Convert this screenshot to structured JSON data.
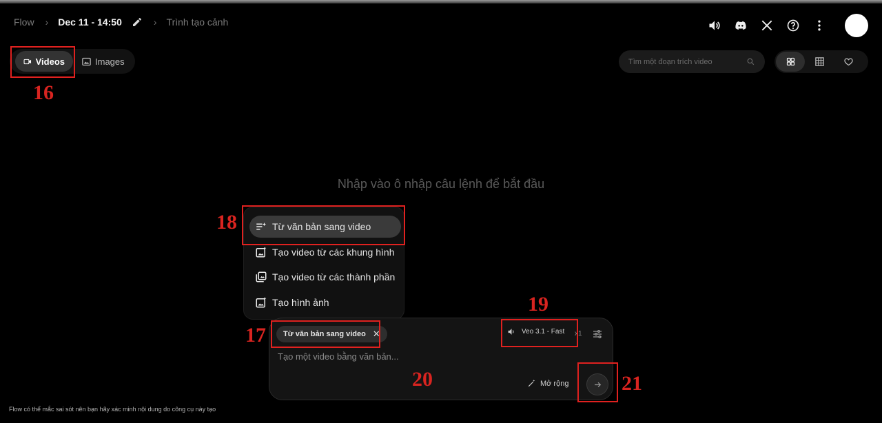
{
  "breadcrumb": {
    "root": "Flow",
    "chevron": "›",
    "project_title": "Dec 11 - 14:50",
    "page": "Trình tạo cảnh"
  },
  "header_icons": [
    "volume-icon",
    "discord-icon",
    "x-logo-icon",
    "help-icon",
    "more-vert-icon"
  ],
  "tabs": [
    {
      "label": "Videos",
      "icon": "videocam-icon",
      "active": true
    },
    {
      "label": "Images",
      "icon": "image-icon",
      "active": false
    }
  ],
  "search": {
    "placeholder": "Tìm một đoạn trích video"
  },
  "views": [
    "grid-icon",
    "grid-small-icon",
    "favorite-icon"
  ],
  "empty_message": "Nhập vào ô nhập câu lệnh để bắt đầu",
  "menu": {
    "items": [
      {
        "label": "Từ văn bản sang video",
        "icon": "text-to-video-icon",
        "selected": true
      },
      {
        "label": "Tạo video từ các khung hình",
        "icon": "frames-icon",
        "selected": false
      },
      {
        "label": "Tạo video từ các thành phần",
        "icon": "ingredients-icon",
        "selected": false
      },
      {
        "label": "Tạo hình ảnh",
        "icon": "create-image-icon",
        "selected": false
      }
    ]
  },
  "composer": {
    "mode_chip": "Từ văn bản sang video",
    "chip_close": "✕",
    "model": "Veo 3.1 - Fast",
    "count": "x1",
    "prompt_placeholder": "Tạo một video bằng văn bản...",
    "expand_label": "Mở rộng"
  },
  "footer": "Flow có thể mắc sai sót nên bạn hãy xác minh nội dung do công cụ này tạo",
  "annotations": [
    "16",
    "17",
    "18",
    "19",
    "20",
    "21"
  ],
  "colors": {
    "background": "#000000",
    "annotation": "#e0211f",
    "selected": "#3a3a3a"
  }
}
